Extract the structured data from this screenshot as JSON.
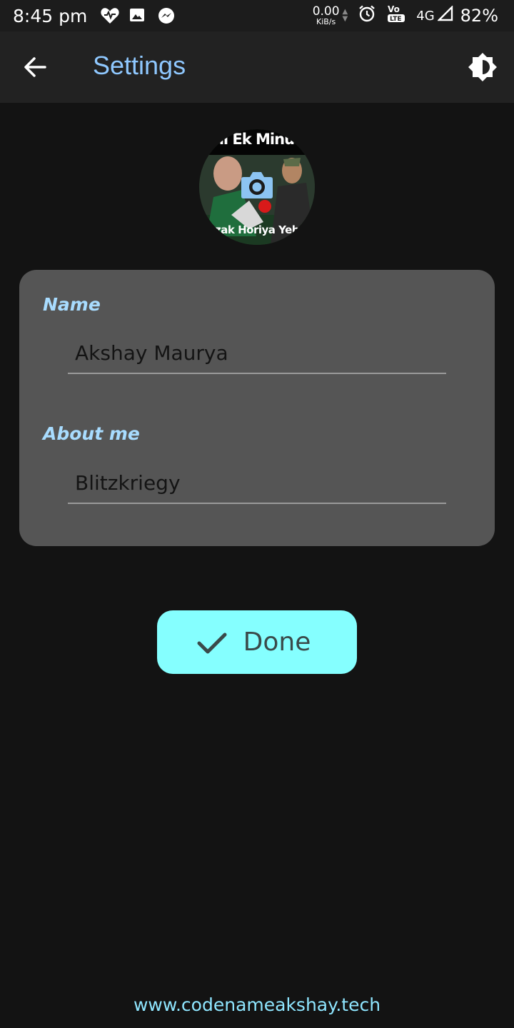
{
  "status_bar": {
    "time": "8:45 pm",
    "net_speed_value": "0.00",
    "net_speed_unit": "KiB/s",
    "volte_label": "LTE",
    "network_type": "4G",
    "battery": "82%",
    "icons": [
      "heart-icon",
      "image-icon",
      "messenger-icon",
      "alarm-icon",
      "volte-icon",
      "signal-icon"
    ]
  },
  "app_bar": {
    "title": "Settings",
    "back_icon": "arrow-left-icon",
    "theme_icon": "brightness-icon"
  },
  "profile": {
    "avatar_caption_top": "ni Ek Minut",
    "avatar_caption_bottom": "zak Horiya Yeh",
    "camera_icon": "camera-icon"
  },
  "form": {
    "name_label": "Name",
    "name_value": "Akshay Maurya",
    "about_label": "About me",
    "about_value": "Blitzkriegy"
  },
  "actions": {
    "done_label": "Done",
    "done_icon": "check-icon"
  },
  "footer": {
    "link": "www.codenameakshay.tech"
  },
  "colors": {
    "background": "#131313",
    "app_bar": "#222222",
    "title": "#8fc8ff",
    "card": "#555555",
    "label": "#a8dcff",
    "button": "#85ffff",
    "footer": "#8fe6ff"
  }
}
